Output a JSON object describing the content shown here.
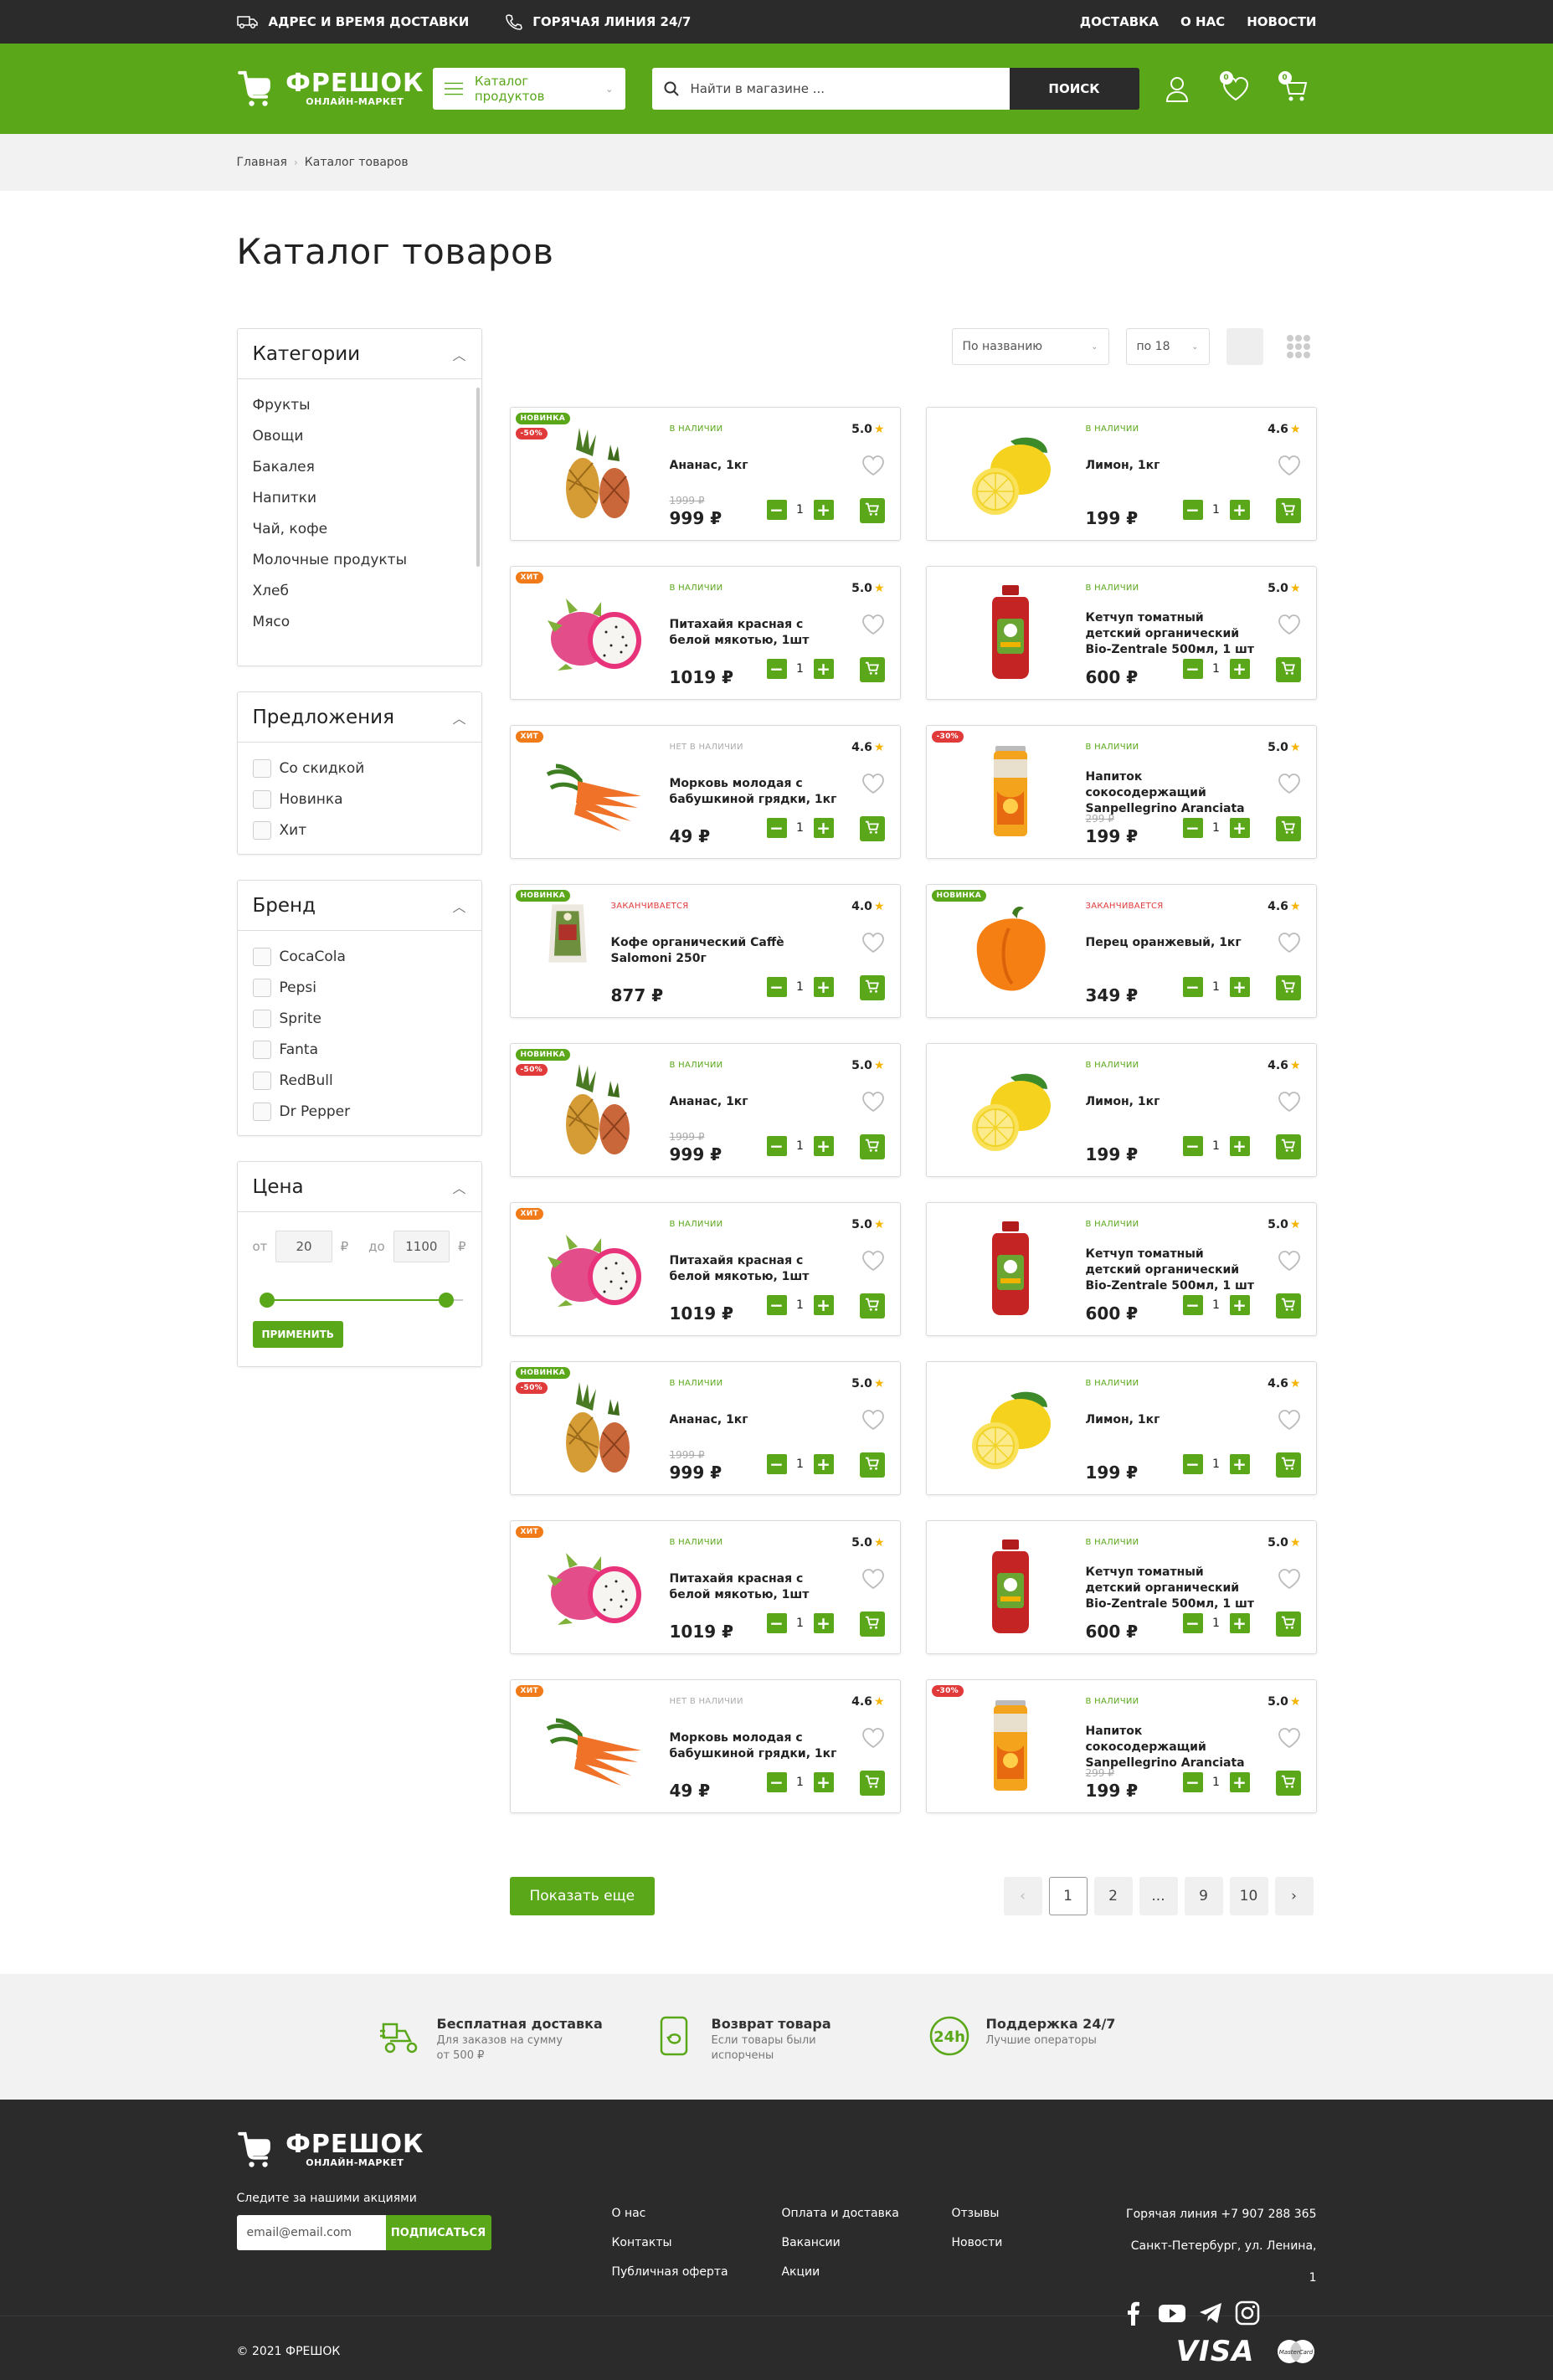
{
  "topbar": {
    "delivery": "АДРЕС И ВРЕМЯ ДОСТАВКИ",
    "hotline": "ГОРЯЧАЯ ЛИНИЯ 24/7",
    "links": [
      "ДОСТАВКА",
      "О НАС",
      "НОВОСТИ"
    ]
  },
  "header": {
    "logo_name": "ФРЕШОК",
    "logo_sub": "ОНЛАЙН-МАРКЕТ",
    "catalog": "Каталог продуктов",
    "search_placeholder": "Найти в магазине ...",
    "search_btn": "ПОИСК",
    "fav_count": "0",
    "cart_count": "0"
  },
  "breadcrumb": [
    "Главная",
    "Каталог товаров"
  ],
  "title": "Каталог товаров",
  "filters": {
    "categories": {
      "title": "Категории",
      "items": [
        "Фрукты",
        "Овощи",
        "Бакалея",
        "Напитки",
        "Чай, кофе",
        "Молочные продукты",
        "Хлеб",
        "Мясо"
      ]
    },
    "offers": {
      "title": "Предложения",
      "items": [
        "Со скидкой",
        "Новинка",
        "Хит"
      ]
    },
    "brand": {
      "title": "Бренд",
      "items": [
        "CocaCola",
        "Pepsi",
        "Sprite",
        "Fanta",
        "RedBull",
        "Dr Pepper"
      ]
    },
    "price": {
      "title": "Цена",
      "from_label": "от",
      "to_label": "до",
      "from": "20",
      "to": "1100",
      "currency": "₽",
      "apply": "ПРИМЕНИТЬ"
    }
  },
  "toolbar": {
    "sort": "По названию",
    "per_page": "по 18"
  },
  "products": [
    {
      "badges": [
        "НОВИНКА",
        "-50%"
      ],
      "avail": "В НАЛИЧИИ",
      "rating": "5.0",
      "name": "Ананас, 1кг",
      "old": "1999 ₽",
      "price": "999 ₽",
      "qty": "1",
      "img": "pineapple"
    },
    {
      "badges": [],
      "avail": "В НАЛИЧИИ",
      "rating": "4.6",
      "name": "Лимон, 1кг",
      "old": "",
      "price": "199 ₽",
      "qty": "1",
      "img": "lemon"
    },
    {
      "badges": [
        "ХИТ"
      ],
      "avail": "В НАЛИЧИИ",
      "rating": "5.0",
      "name": "Питахайя красная с белой мякотью, 1шт",
      "old": "",
      "price": "1019 ₽",
      "qty": "1",
      "img": "dragon"
    },
    {
      "badges": [],
      "avail": "В НАЛИЧИИ",
      "rating": "5.0",
      "name": "Кетчуп томатный детский органический Bio-Zentrale 500мл, 1 шт",
      "old": "",
      "price": "600 ₽",
      "qty": "1",
      "img": "ketchup"
    },
    {
      "badges": [
        "ХИТ"
      ],
      "avail": "НЕТ В НАЛИЧИИ",
      "rating": "4.6",
      "name": "Морковь молодая с бабушкиной грядки, 1кг",
      "old": "",
      "price": "49 ₽",
      "qty": "1",
      "img": "carrot"
    },
    {
      "badges": [
        "-30%"
      ],
      "avail": "В НАЛИЧИИ",
      "rating": "5.0",
      "name": "Напиток сокосодержащий Sanpellegrino Aranciata Orange Красный апельси...",
      "old": "299 ₽",
      "price": "199 ₽",
      "qty": "1",
      "img": "can"
    },
    {
      "badges": [
        "НОВИНКА"
      ],
      "avail": "ЗАКАНЧИВАЕТСЯ",
      "rating": "4.0",
      "name": "Кофе органический Caffè Salomoni 250г",
      "old": "",
      "price": "877 ₽",
      "qty": "1",
      "img": "coffee"
    },
    {
      "badges": [
        "НОВИНКА"
      ],
      "avail": "ЗАКАНЧИВАЕТСЯ",
      "rating": "4.6",
      "name": "Перец оранжевый, 1кг",
      "old": "",
      "price": "349 ₽",
      "qty": "1",
      "img": "pepper"
    },
    {
      "badges": [
        "НОВИНКА",
        "-50%"
      ],
      "avail": "В НАЛИЧИИ",
      "rating": "5.0",
      "name": "Ананас, 1кг",
      "old": "1999 ₽",
      "price": "999 ₽",
      "qty": "1",
      "img": "pineapple"
    },
    {
      "badges": [],
      "avail": "В НАЛИЧИИ",
      "rating": "4.6",
      "name": "Лимон, 1кг",
      "old": "",
      "price": "199 ₽",
      "qty": "1",
      "img": "lemon"
    },
    {
      "badges": [
        "ХИТ"
      ],
      "avail": "В НАЛИЧИИ",
      "rating": "5.0",
      "name": "Питахайя красная с белой мякотью, 1шт",
      "old": "",
      "price": "1019 ₽",
      "qty": "1",
      "img": "dragon"
    },
    {
      "badges": [],
      "avail": "В НАЛИЧИИ",
      "rating": "5.0",
      "name": "Кетчуп томатный детский органический Bio-Zentrale 500мл, 1 шт",
      "old": "",
      "price": "600 ₽",
      "qty": "1",
      "img": "ketchup"
    },
    {
      "badges": [
        "НОВИНКА",
        "-50%"
      ],
      "avail": "В НАЛИЧИИ",
      "rating": "5.0",
      "name": "Ананас, 1кг",
      "old": "1999 ₽",
      "price": "999 ₽",
      "qty": "1",
      "img": "pineapple"
    },
    {
      "badges": [],
      "avail": "В НАЛИЧИИ",
      "rating": "4.6",
      "name": "Лимон, 1кг",
      "old": "",
      "price": "199 ₽",
      "qty": "1",
      "img": "lemon"
    },
    {
      "badges": [
        "ХИТ"
      ],
      "avail": "В НАЛИЧИИ",
      "rating": "5.0",
      "name": "Питахайя красная с белой мякотью, 1шт",
      "old": "",
      "price": "1019 ₽",
      "qty": "1",
      "img": "dragon"
    },
    {
      "badges": [],
      "avail": "В НАЛИЧИИ",
      "rating": "5.0",
      "name": "Кетчуп томатный детский органический Bio-Zentrale 500мл, 1 шт",
      "old": "",
      "price": "600 ₽",
      "qty": "1",
      "img": "ketchup"
    },
    {
      "badges": [
        "ХИТ"
      ],
      "avail": "НЕТ В НАЛИЧИИ",
      "rating": "4.6",
      "name": "Морковь молодая с бабушкиной грядки, 1кг",
      "old": "",
      "price": "49 ₽",
      "qty": "1",
      "img": "carrot"
    },
    {
      "badges": [
        "-30%"
      ],
      "avail": "В НАЛИЧИИ",
      "rating": "5.0",
      "name": "Напиток сокосодержащий Sanpellegrino Aranciata Orange Красный апельси...",
      "old": "299 ₽",
      "price": "199 ₽",
      "qty": "1",
      "img": "can"
    }
  ],
  "paging": {
    "more": "Показать еще",
    "pages": [
      "1",
      "2",
      "...",
      "9",
      "10"
    ]
  },
  "features": [
    {
      "title": "Бесплатная доставка",
      "sub": "Для заказов на сумму от 500 ₽"
    },
    {
      "title": "Возврат товара",
      "sub": "Если товары были испорчены"
    },
    {
      "title": "Поддержка 24/7",
      "sub": "Лучшие операторы"
    }
  ],
  "footer": {
    "follow": "Следите за нашими акциями",
    "email_placeholder": "email@email.com",
    "subscribe": "ПОДПИСАТЬСЯ",
    "col1": [
      "О нас",
      "Контакты",
      "Публичная оферта"
    ],
    "col2": [
      "Оплата и доставка",
      "Вакансии",
      "Акции"
    ],
    "col3": [
      "Отзывы",
      "Новости"
    ],
    "hotline": "Горячая линия +7 907 288 365",
    "address": "Санкт-Петербург, ул. Ленина, 1",
    "copyright": "© 2021 ФРЕШОК",
    "visa": "VISA",
    "mastercard": "MasterCard"
  },
  "colors": {
    "brand": "#5aa71a",
    "dark": "#2b2b2b",
    "hit": "#f07b18",
    "sale": "#e03a3a"
  }
}
